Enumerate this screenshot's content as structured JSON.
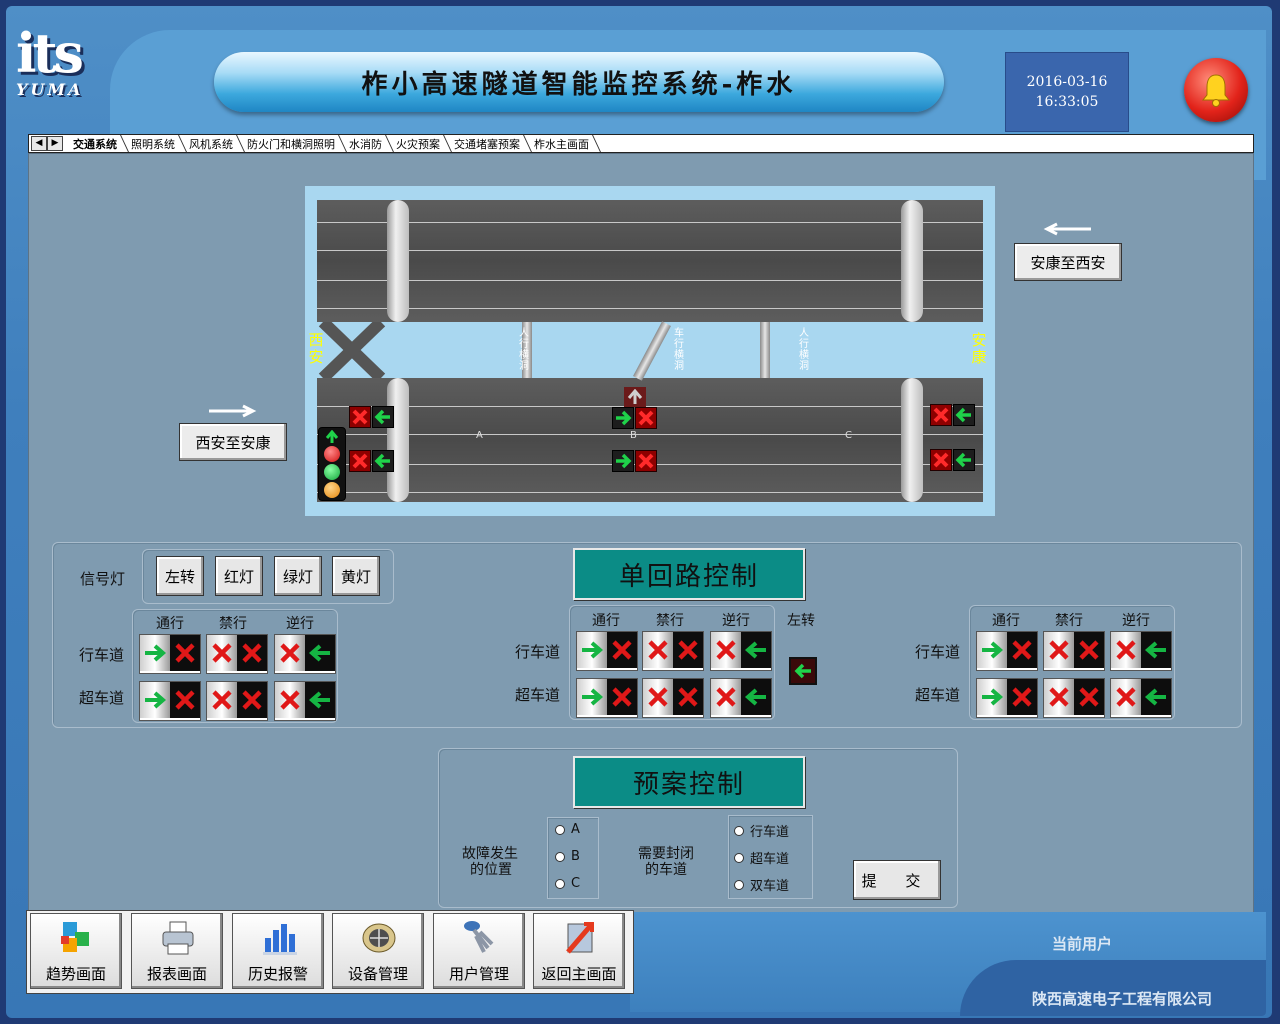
{
  "app": {
    "logo_text": "its",
    "logo_sub": "YUMA",
    "title": "柞小高速隧道智能监控系统-柞水",
    "date": "2016-03-16",
    "time": "16:33:05"
  },
  "tabs": [
    {
      "label": "交通系统",
      "active": true
    },
    {
      "label": "照明系统"
    },
    {
      "label": "风机系统"
    },
    {
      "label": "防火门和横洞照明"
    },
    {
      "label": "水消防"
    },
    {
      "label": "火灾预案"
    },
    {
      "label": "交通堵塞预案"
    },
    {
      "label": "柞水主画面"
    }
  ],
  "tunnel": {
    "left_end": "西安",
    "right_end": "安康",
    "passages": [
      "人行横洞",
      "车行横洞",
      "人行横洞"
    ],
    "lane_marks": [
      "A",
      "B",
      "C"
    ],
    "btn_west_to_east": "西安至安康",
    "btn_east_to_west": "安康至西安"
  },
  "signal_panel": {
    "label": "信号灯",
    "buttons": [
      "左转",
      "红灯",
      "绿灯",
      "黄灯"
    ]
  },
  "lane_control": {
    "cols": [
      "通行",
      "禁行",
      "逆行"
    ],
    "rows": [
      "行车道",
      "超车道"
    ],
    "left_turn": "左转"
  },
  "single_loop": {
    "title": "单回路控制"
  },
  "plan": {
    "title": "预案控制",
    "fault_label_1": "故障发生",
    "fault_label_2": "的位置",
    "fault_options": [
      "A",
      "B",
      "C"
    ],
    "close_label_1": "需要封闭",
    "close_label_2": "的车道",
    "close_options": [
      "行车道",
      "超车道",
      "双车道"
    ],
    "submit": "提  交"
  },
  "nav": [
    {
      "label": "趋势画面",
      "icon": "cubes-icon"
    },
    {
      "label": "报表画面",
      "icon": "printer-icon"
    },
    {
      "label": "历史报警",
      "icon": "bar-chart-icon"
    },
    {
      "label": "设备管理",
      "icon": "globe-icon"
    },
    {
      "label": "用户管理",
      "icon": "keys-icon"
    },
    {
      "label": "返回主画面",
      "icon": "return-icon"
    }
  ],
  "footer": {
    "current_user": "当前用户",
    "company": "陕西高速电子工程有限公司"
  },
  "colors": {
    "frame_blue": "#4f8fc7",
    "workspace": "#7f9bb0",
    "teal_title": "#0b8c86",
    "signal_green": "#19c24a",
    "signal_red": "#e01818",
    "lane_yellow": "#ffff00"
  }
}
